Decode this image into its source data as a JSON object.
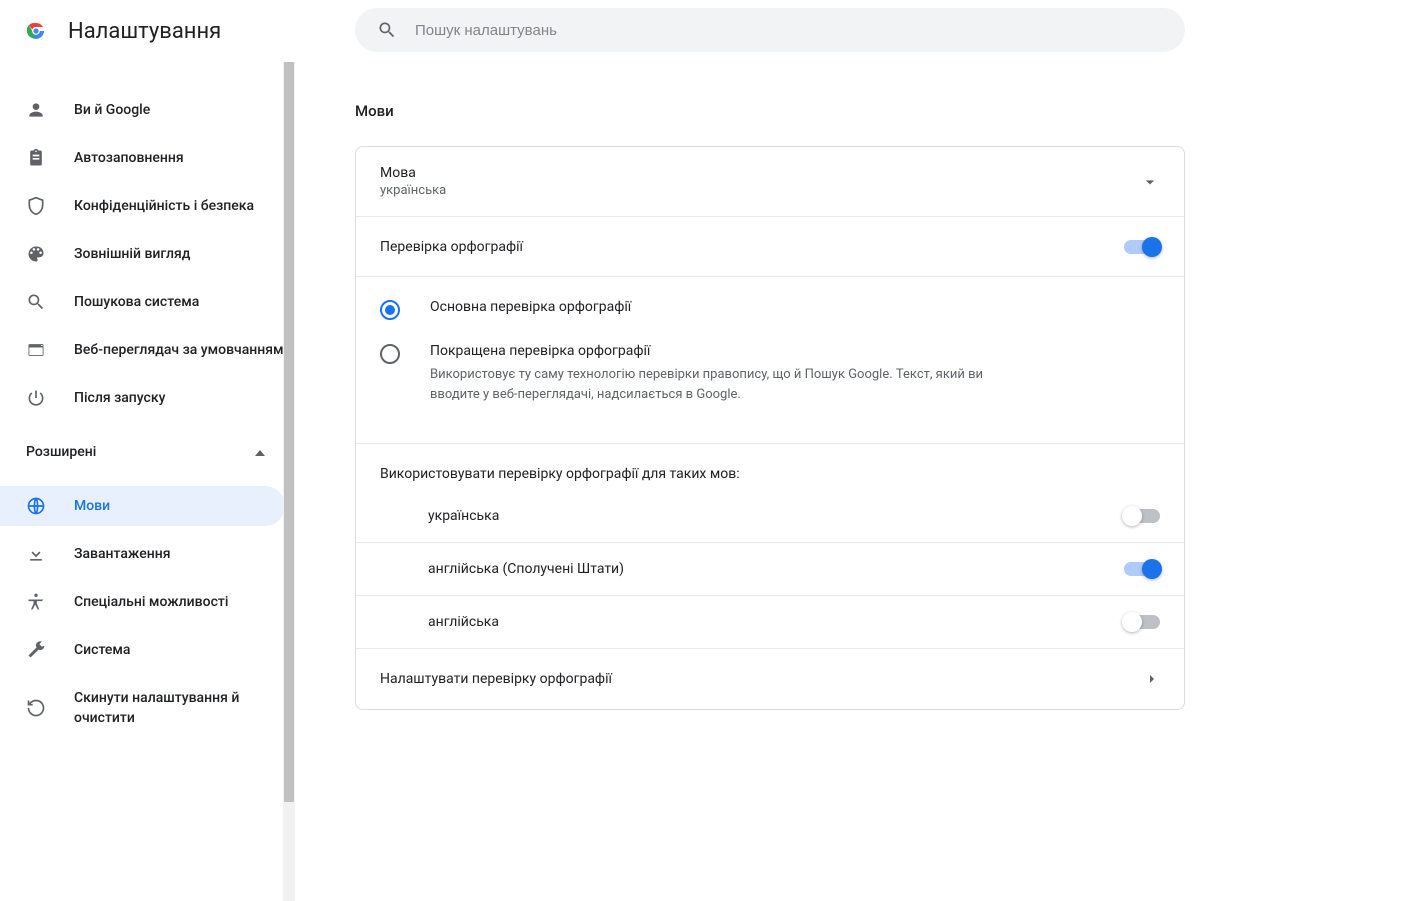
{
  "header": {
    "title": "Налаштування"
  },
  "search": {
    "placeholder": "Пошук налаштувань"
  },
  "sidebar": {
    "items": [
      {
        "label": "Ви й Google"
      },
      {
        "label": "Автозаповнення"
      },
      {
        "label": "Конфіденційність і безпека"
      },
      {
        "label": "Зовнішній вигляд"
      },
      {
        "label": "Пошукова система"
      },
      {
        "label": "Веб-переглядач за умовчанням"
      },
      {
        "label": "Після запуску"
      }
    ],
    "advanced_label": "Розширені",
    "advanced_items": [
      {
        "label": "Мови"
      },
      {
        "label": "Завантаження"
      },
      {
        "label": "Спеціальні можливості"
      },
      {
        "label": "Система"
      },
      {
        "label": "Скинути налаштування й очистити"
      }
    ]
  },
  "page": {
    "heading": "Мови",
    "lang_section": {
      "title": "Мова",
      "current": "українська"
    },
    "spellcheck": {
      "title": "Перевірка орфографії",
      "enabled": true,
      "options": {
        "basic": {
          "label": "Основна перевірка орфографії"
        },
        "enhanced": {
          "label": "Покращена перевірка орфографії",
          "desc": "Використовує ту саму технологію перевірки правопису, що й Пошук Google. Текст, який ви вводите у веб-переглядачі, надсилається в Google."
        }
      },
      "use_for_label": "Використовувати перевірку орфографії для таких мов:",
      "langs": [
        {
          "name": "українська",
          "on": false
        },
        {
          "name": "англійська (Сполучені Штати)",
          "on": true
        },
        {
          "name": "англійська",
          "on": false
        }
      ],
      "customize_label": "Налаштувати перевірку орфографії"
    }
  }
}
